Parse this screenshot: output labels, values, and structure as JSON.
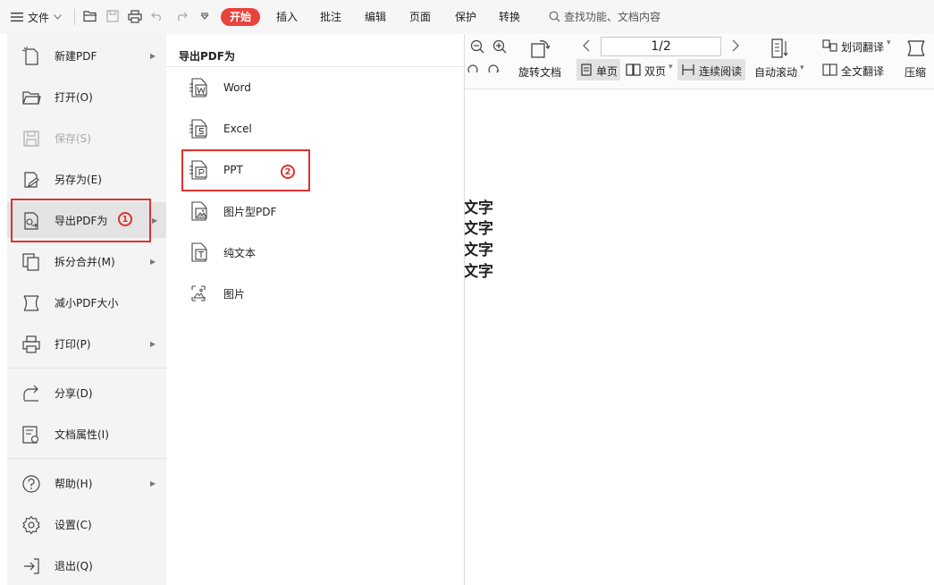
{
  "topbar": {
    "file_label": "文件",
    "tabs": [
      {
        "label": "开始",
        "active": true
      },
      {
        "label": "插入"
      },
      {
        "label": "批注"
      },
      {
        "label": "编辑"
      },
      {
        "label": "页面"
      },
      {
        "label": "保护"
      },
      {
        "label": "转换"
      }
    ],
    "search_placeholder": "查找功能、文档内容"
  },
  "ribbon": {
    "rotate_label": "旋转文档",
    "page_indicator": "1/2",
    "single_page_label": "单页",
    "double_page_label": "双页",
    "continuous_label": "连续阅读",
    "auto_scroll_label": "自动滚动",
    "word_translate_label": "划词翻译",
    "full_translate_label": "全文翻译",
    "compress_label": "压缩"
  },
  "file_menu": {
    "items": [
      {
        "label": "新建PDF",
        "icon": "new-pdf-icon",
        "has_submenu": true
      },
      {
        "label": "打开(O)",
        "icon": "folder-open-icon"
      },
      {
        "label": "保存(S)",
        "icon": "save-icon",
        "disabled": true
      },
      {
        "label": "另存为(E)",
        "icon": "save-as-icon"
      },
      {
        "label": "导出PDF为",
        "icon": "export-pdf-icon",
        "has_submenu": true,
        "selected": true
      },
      {
        "label": "拆分合并(M)",
        "icon": "split-merge-icon",
        "has_submenu": true
      },
      {
        "label": "减小PDF大小",
        "icon": "compress-icon"
      },
      {
        "label": "打印(P)",
        "icon": "printer-icon",
        "has_submenu": true
      },
      {
        "label": "分享(D)",
        "icon": "share-icon"
      },
      {
        "label": "文档属性(I)",
        "icon": "properties-icon"
      },
      {
        "label": "帮助(H)",
        "icon": "help-icon",
        "has_submenu": true
      },
      {
        "label": "设置(C)",
        "icon": "gear-icon"
      },
      {
        "label": "退出(Q)",
        "icon": "exit-icon"
      }
    ]
  },
  "submenu": {
    "title": "导出PDF为",
    "items": [
      {
        "label": "Word",
        "icon": "word-icon"
      },
      {
        "label": "Excel",
        "icon": "excel-icon"
      },
      {
        "label": "PPT",
        "icon": "ppt-icon"
      },
      {
        "label": "图片型PDF",
        "icon": "image-pdf-icon"
      },
      {
        "label": "纯文本",
        "icon": "plain-text-icon"
      },
      {
        "label": "图片",
        "icon": "image-icon"
      }
    ]
  },
  "annotations": {
    "badge_1": "1",
    "badge_2": "2",
    "color": "#e0312e"
  },
  "document": {
    "lines": [
      "文字",
      "文字",
      "文字",
      "文字"
    ]
  },
  "colors": {
    "accent": "#e8433c",
    "menu_bg": "#f4f4f4"
  }
}
